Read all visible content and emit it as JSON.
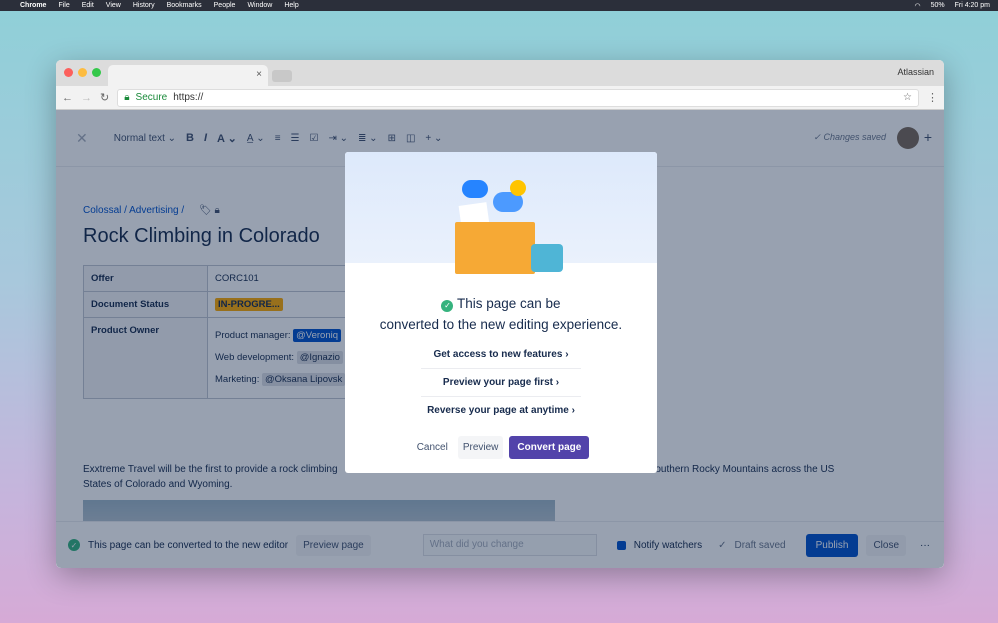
{
  "menubar": {
    "app": "Chrome",
    "items": [
      "File",
      "Edit",
      "View",
      "History",
      "Bookmarks",
      "People",
      "Window",
      "Help"
    ],
    "battery": "50%",
    "clock": "Fri 4:20 pm"
  },
  "browser": {
    "profile": "Atlassian",
    "secure": "Secure",
    "url": "https://"
  },
  "toolbar": {
    "text_style": "Normal text",
    "status": "Changes saved"
  },
  "page": {
    "breadcrumb": "Colossal / Advertising /",
    "title": "Rock Climbing in Colorado",
    "table": {
      "offer_label": "Offer",
      "offer_value": "CORC101",
      "status_label": "Document Status",
      "status_value": "IN-PROGRE...",
      "owner_label": "Product Owner",
      "owners": [
        {
          "role": "Product manager:",
          "mention": "@Veroniq"
        },
        {
          "role": "Web development:",
          "mention": "@Ignazio"
        },
        {
          "role": "Marketing:",
          "mention": "@Oksana Lipovsk"
        }
      ]
    },
    "paragraph_left": "Exxtreme Travel will be the first to provide a rock climbing",
    "paragraph_right": "ce of the Southern Rocky Mountains across the US",
    "paragraph_line2": "States of Colorado and Wyoming."
  },
  "footer": {
    "convert_msg": "This page can be converted to the new editor",
    "preview_page": "Preview page",
    "change_placeholder": "What did you change",
    "notify": "Notify watchers",
    "draft": "Draft saved",
    "publish": "Publish",
    "close": "Close",
    "more": "···"
  },
  "modal": {
    "heading_line1": "This page can be",
    "heading_line2": "converted to the new editing experience.",
    "links": [
      "Get access to new features",
      "Preview your page first",
      "Reverse your page at anytime"
    ],
    "cancel": "Cancel",
    "preview": "Preview",
    "convert": "Convert page"
  },
  "colors": {
    "primary": "#0052cc",
    "convert": "#5243aa",
    "success": "#36b37e"
  }
}
